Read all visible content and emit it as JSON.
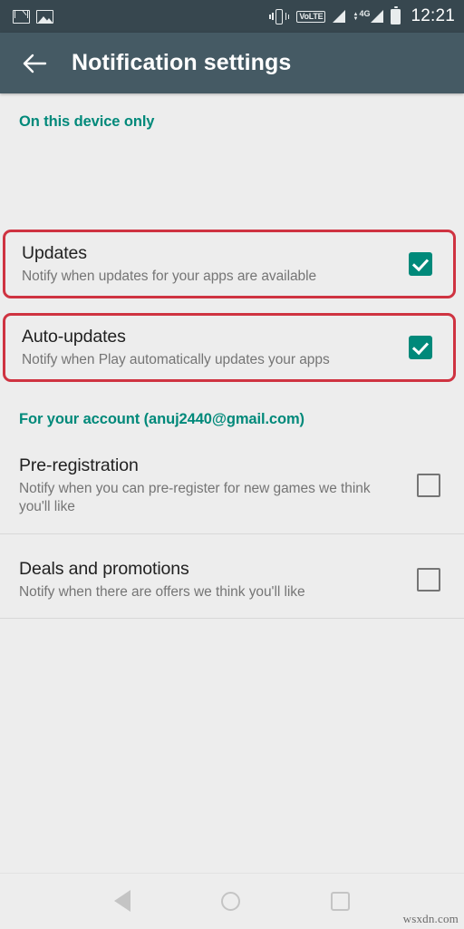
{
  "status_bar": {
    "time": "12:21",
    "left_icons": [
      "gmail-icon",
      "photo-icon"
    ],
    "right_icons": [
      "vibrate-icon",
      "volte-icon",
      "signal-icon",
      "network-4g-icon",
      "battery-icon"
    ],
    "volte_label": "VoLTE",
    "network_label": "4G",
    "background_color": "#37474f"
  },
  "app_bar": {
    "title": "Notification settings",
    "back_icon": "back-arrow-icon",
    "background_color": "#455a64"
  },
  "sections": [
    {
      "header": "On this device only",
      "header_color": "#00897a",
      "rows": [
        {
          "title": "Updates",
          "subtitle": "Notify when updates for your apps are available",
          "checked": true,
          "highlighted": true
        },
        {
          "title": "Auto-updates",
          "subtitle": "Notify when Play automatically updates your apps",
          "checked": true,
          "highlighted": true
        }
      ]
    },
    {
      "header": "For your account (anuj2440@gmail.com)",
      "header_color": "#00897a",
      "rows": [
        {
          "title": "Pre-registration",
          "subtitle": "Notify when you can pre-register for new games we think you'll like",
          "checked": false,
          "highlighted": false
        },
        {
          "title": "Deals and promotions",
          "subtitle": "Notify when there are offers we think you'll like",
          "checked": false,
          "highlighted": false
        }
      ]
    }
  ],
  "colors": {
    "accent_teal": "#00897a",
    "highlight_red": "#cf3341",
    "page_background": "#ededed",
    "title_text": "#212121",
    "subtitle_text": "#757575"
  },
  "nav_bar": {
    "back": "nav-back-icon",
    "home": "nav-home-icon",
    "recents": "nav-recents-icon"
  },
  "watermark": "wsxdn.com"
}
